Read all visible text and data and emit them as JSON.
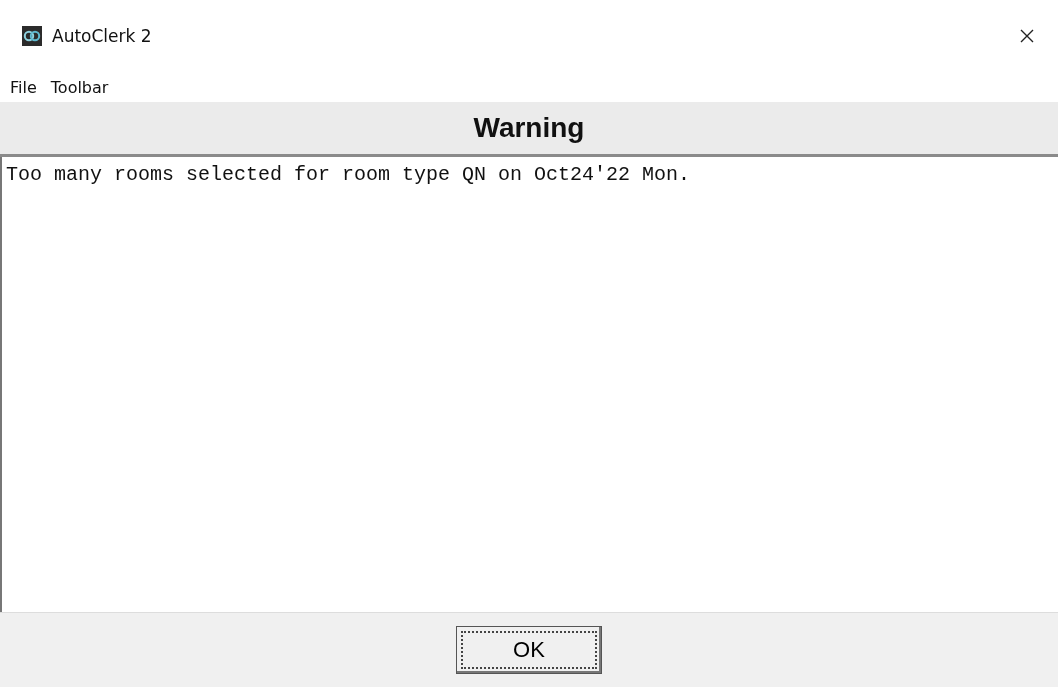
{
  "window": {
    "title": "AutoClerk 2"
  },
  "menu": [
    "File",
    "Toolbar"
  ],
  "dialog": {
    "heading": "Warning",
    "message": "Too many rooms selected for room type QN on Oct24'22 Mon.",
    "buttons": [
      {
        "label": "OK",
        "focused": true
      }
    ]
  }
}
